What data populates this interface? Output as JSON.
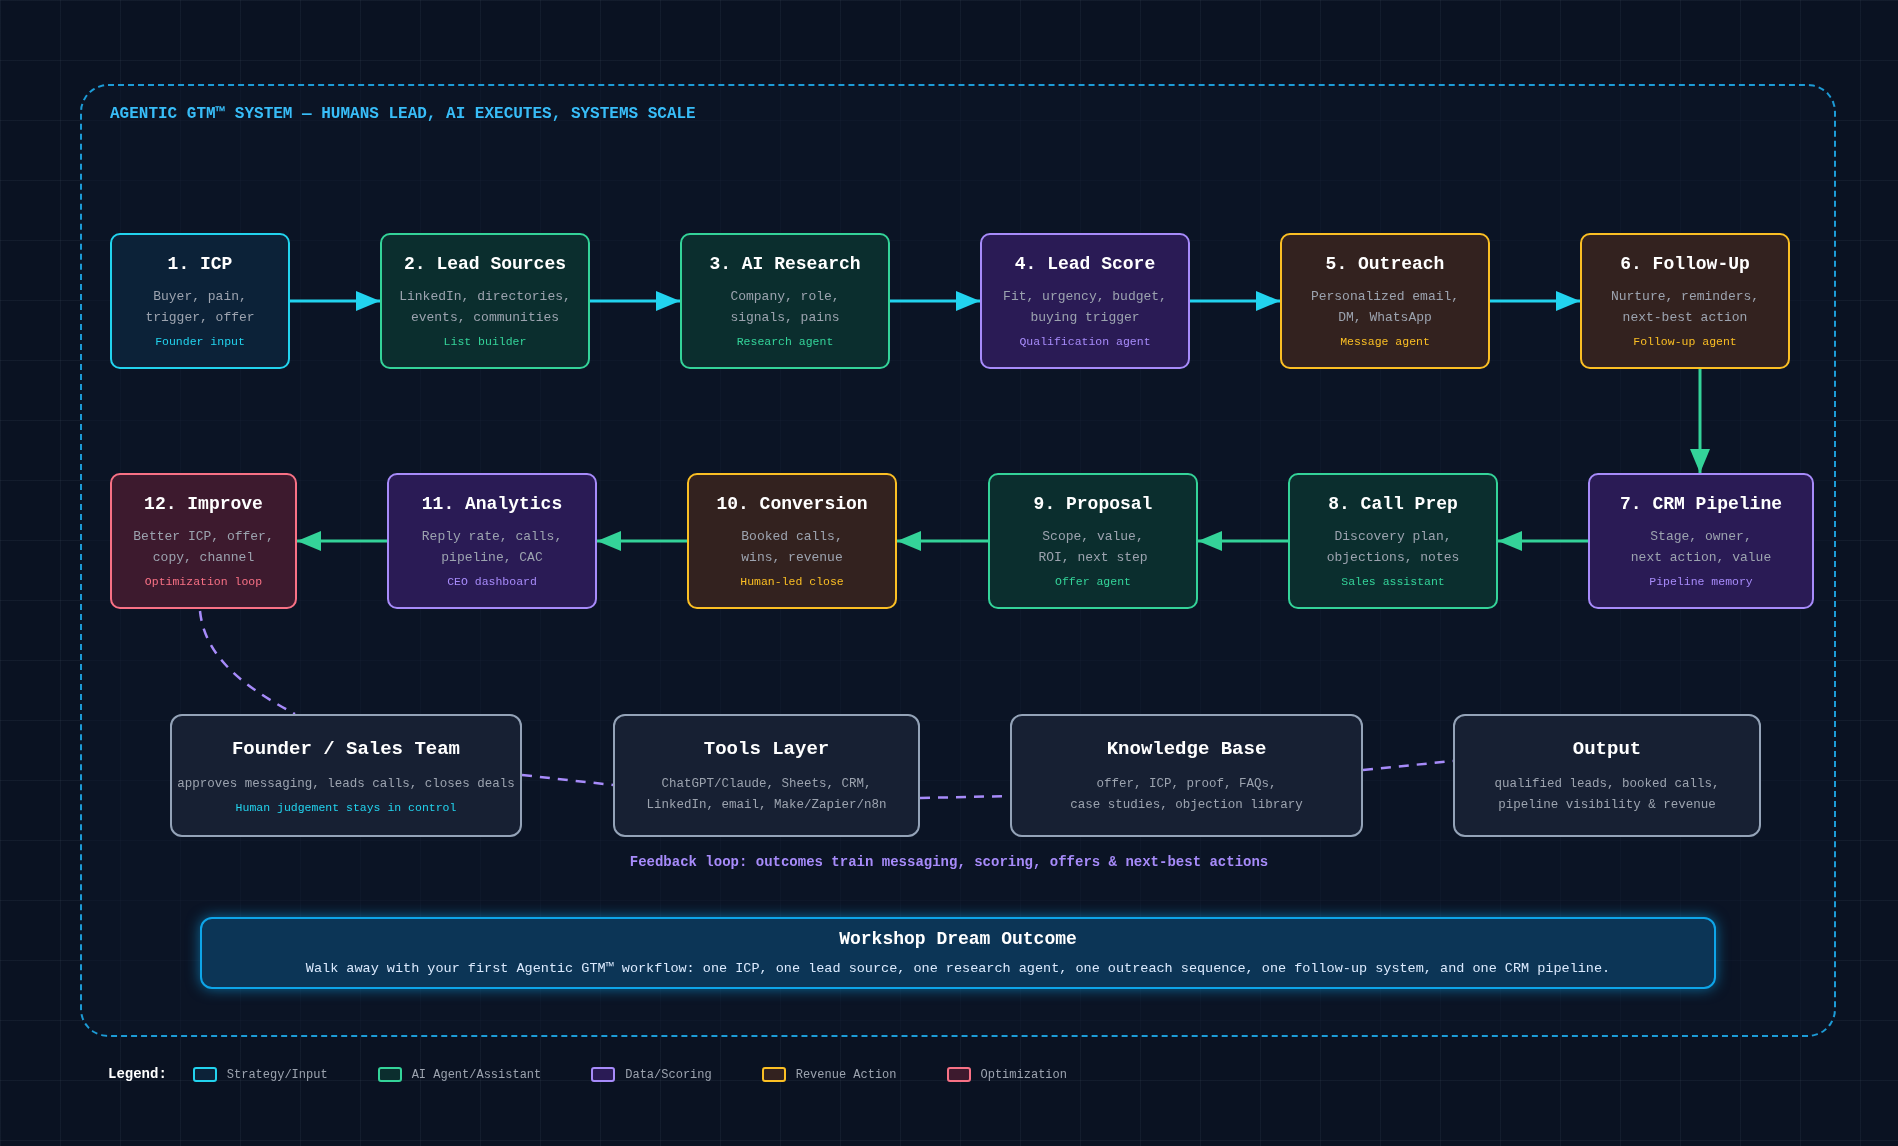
{
  "title": "AGENTIC GTM™ SYSTEM — HUMANS LEAD, AI EXECUTES, SYSTEMS SCALE",
  "top_row": [
    {
      "title": "1. ICP",
      "description": "Buyer, pain,\ntrigger, offer",
      "role": "Founder input",
      "kind": "strategy"
    },
    {
      "title": "2. Lead Sources",
      "description": "LinkedIn, directories,\nevents, communities",
      "role": "List builder",
      "kind": "agent"
    },
    {
      "title": "3. AI Research",
      "description": "Company, role,\nsignals, pains",
      "role": "Research agent",
      "kind": "agent"
    },
    {
      "title": "4. Lead Score",
      "description": "Fit, urgency, budget,\nbuying trigger",
      "role": "Qualification agent",
      "kind": "data"
    },
    {
      "title": "5. Outreach",
      "description": "Personalized email,\nDM, WhatsApp",
      "role": "Message agent",
      "kind": "revenue"
    },
    {
      "title": "6. Follow-Up",
      "description": "Nurture, reminders,\nnext-best action",
      "role": "Follow-up agent",
      "kind": "revenue"
    }
  ],
  "bottom_row": [
    {
      "title": "12. Improve",
      "description": "Better ICP, offer,\ncopy, channel",
      "role": "Optimization loop",
      "kind": "optimization"
    },
    {
      "title": "11. Analytics",
      "description": "Reply rate, calls,\npipeline, CAC",
      "role": "CEO dashboard",
      "kind": "data"
    },
    {
      "title": "10. Conversion",
      "description": "Booked calls,\nwins, revenue",
      "role": "Human-led close",
      "kind": "revenue"
    },
    {
      "title": "9. Proposal",
      "description": "Scope, value,\nROI, next step",
      "role": "Offer agent",
      "kind": "agent"
    },
    {
      "title": "8. Call Prep",
      "description": "Discovery plan,\nobjections, notes",
      "role": "Sales assistant",
      "kind": "agent"
    },
    {
      "title": "7. CRM Pipeline",
      "description": "Stage, owner,\nnext action, value",
      "role": "Pipeline memory",
      "kind": "data"
    }
  ],
  "layers": [
    {
      "title": "Founder / Sales Team",
      "description": "approves messaging, leads calls, closes deals",
      "note": "Human judgement stays in control"
    },
    {
      "title": "Tools Layer",
      "description": "ChatGPT/Claude, Sheets, CRM,\nLinkedIn, email, Make/Zapier/n8n"
    },
    {
      "title": "Knowledge Base",
      "description": "offer, ICP, proof, FAQs,\ncase studies, objection library"
    },
    {
      "title": "Output",
      "description": "qualified leads, booked calls,\npipeline visibility & revenue"
    }
  ],
  "feedback_loop": "Feedback loop: outcomes train messaging, scoring, offers & next-best actions",
  "outcome": {
    "title": "Workshop Dream Outcome",
    "text": "Walk away with your first Agentic GTM™ workflow: one ICP, one lead source, one research agent, one outreach sequence, one follow-up system, and one CRM pipeline."
  },
  "legend": {
    "label": "Legend:",
    "items": [
      {
        "label": "Strategy/Input",
        "kind": "strategy"
      },
      {
        "label": "AI Agent/Assistant",
        "kind": "agent"
      },
      {
        "label": "Data/Scoring",
        "kind": "data"
      },
      {
        "label": "Revenue Action",
        "kind": "revenue"
      },
      {
        "label": "Optimization",
        "kind": "optimization"
      }
    ]
  }
}
